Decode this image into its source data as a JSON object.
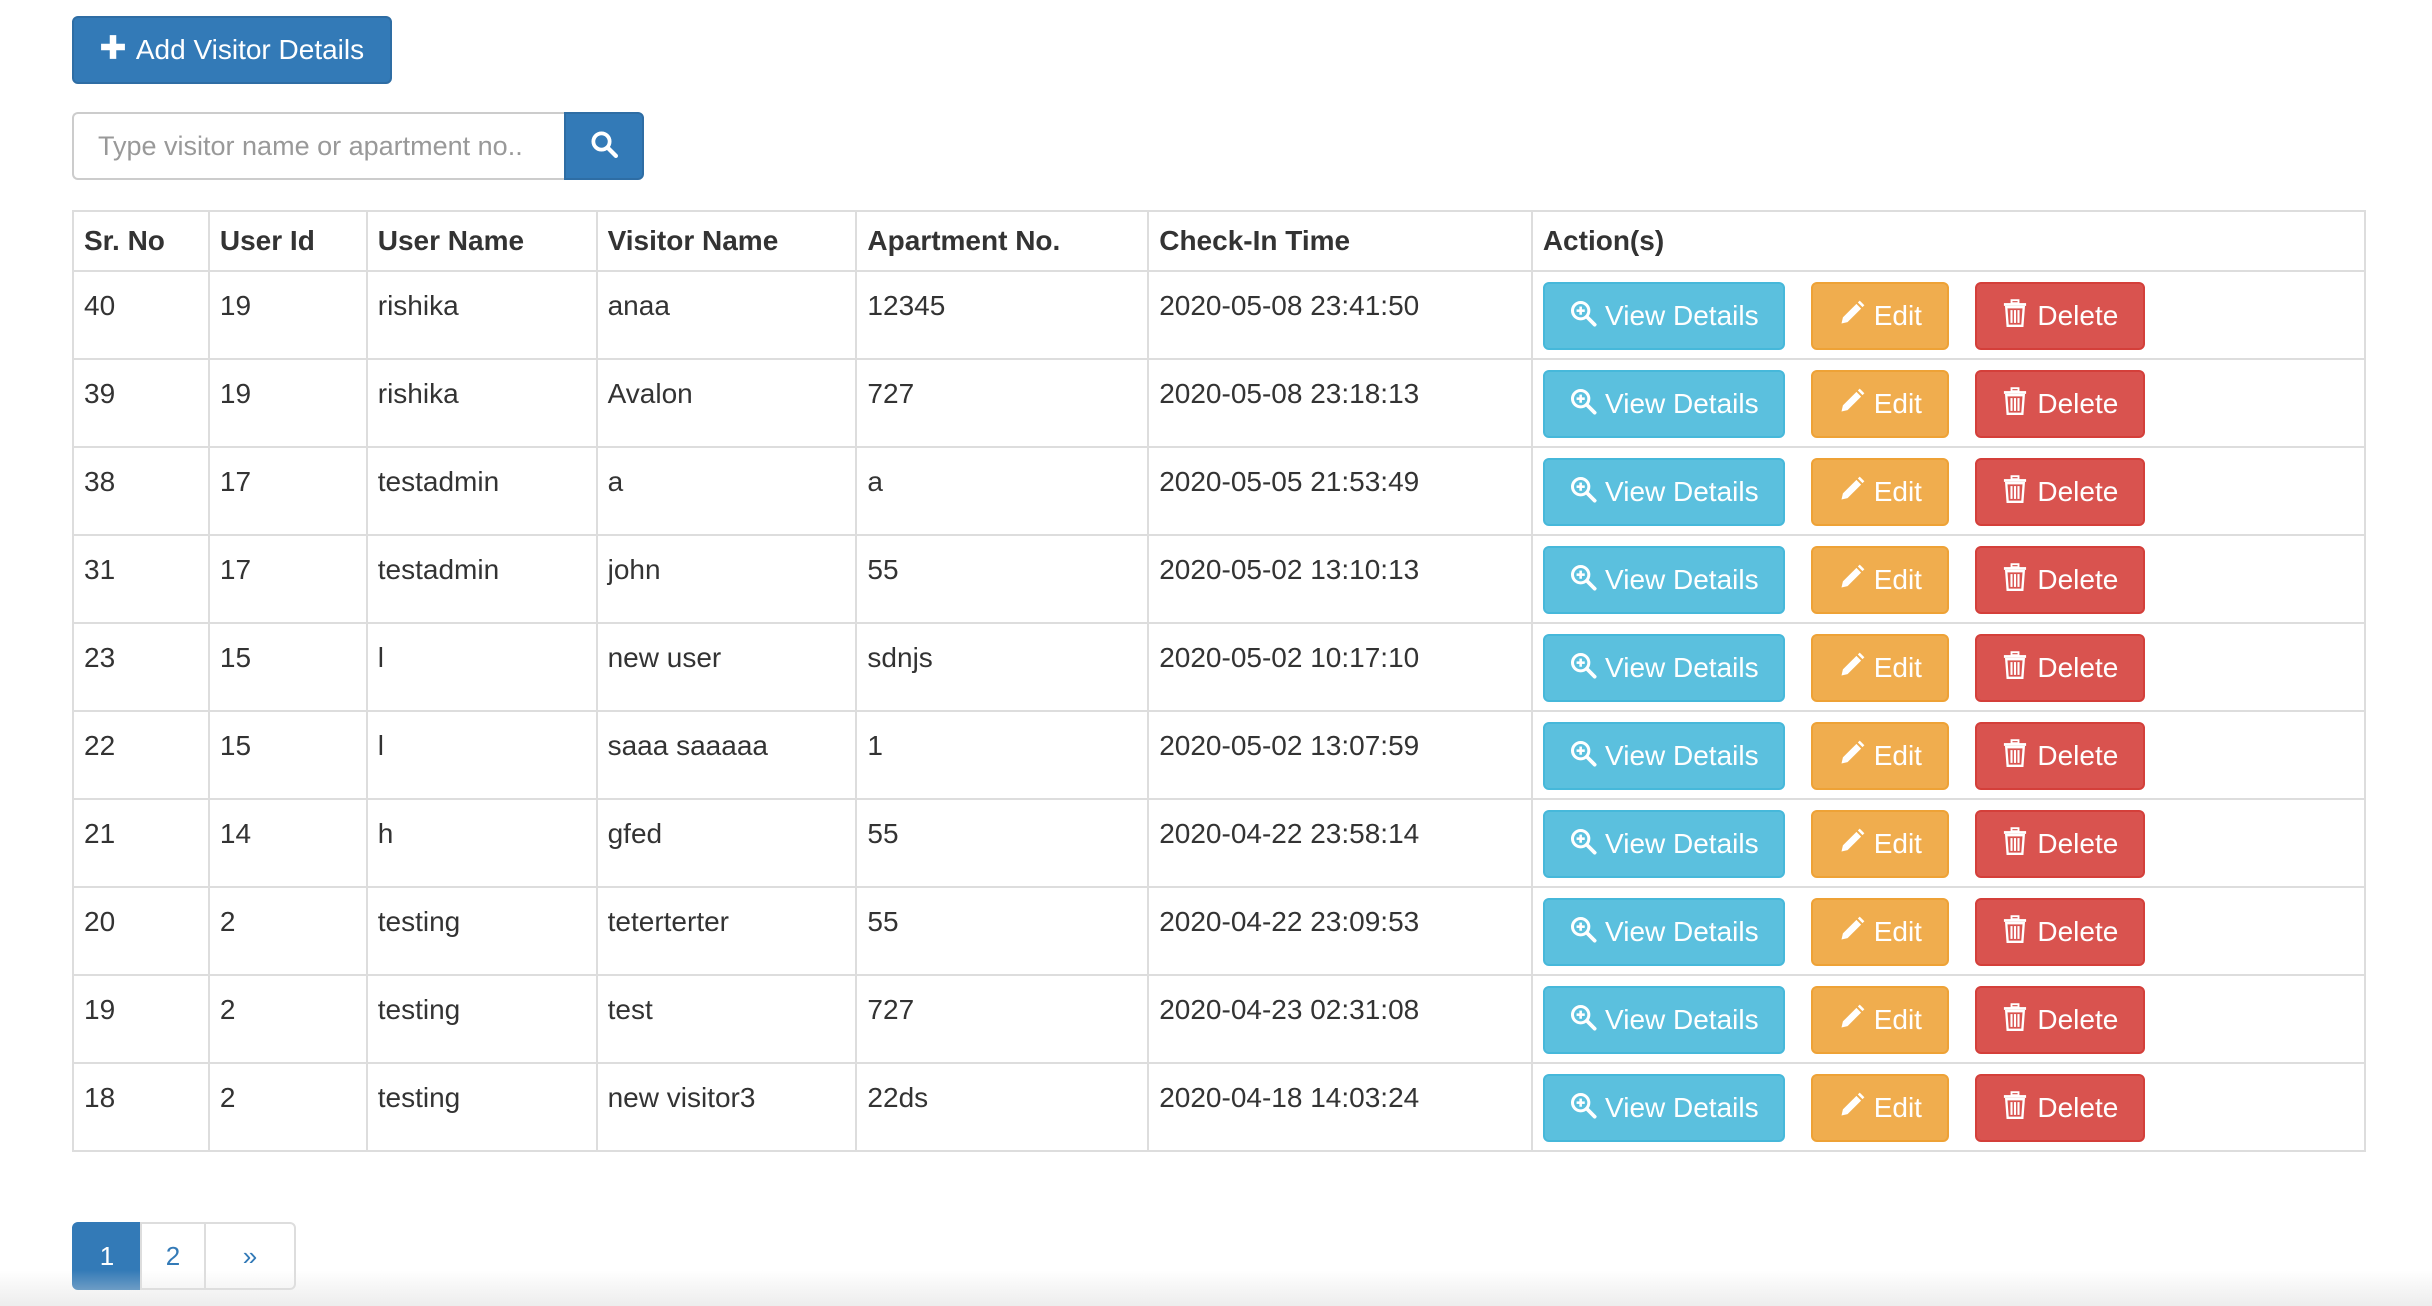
{
  "toolbar": {
    "add_label": "Add Visitor Details"
  },
  "search": {
    "placeholder": "Type visitor name or apartment no.."
  },
  "table": {
    "headers": [
      "Sr. No",
      "User Id",
      "User Name",
      "Visitor Name",
      "Apartment No.",
      "Check-In Time",
      "Action(s)"
    ],
    "rows": [
      {
        "sr": "40",
        "user_id": "19",
        "user_name": "rishika",
        "visitor": "anaa",
        "apt": "12345",
        "time": "2020-05-08 23:41:50"
      },
      {
        "sr": "39",
        "user_id": "19",
        "user_name": "rishika",
        "visitor": "Avalon",
        "apt": "727",
        "time": "2020-05-08 23:18:13"
      },
      {
        "sr": "38",
        "user_id": "17",
        "user_name": "testadmin",
        "visitor": "a",
        "apt": "a",
        "time": "2020-05-05 21:53:49"
      },
      {
        "sr": "31",
        "user_id": "17",
        "user_name": "testadmin",
        "visitor": "john",
        "apt": "55",
        "time": "2020-05-02 13:10:13"
      },
      {
        "sr": "23",
        "user_id": "15",
        "user_name": "l",
        "visitor": "new user",
        "apt": "sdnjs",
        "time": "2020-05-02 10:17:10"
      },
      {
        "sr": "22",
        "user_id": "15",
        "user_name": "l",
        "visitor": "saaa saaaaa",
        "apt": "1",
        "time": "2020-05-02 13:07:59"
      },
      {
        "sr": "21",
        "user_id": "14",
        "user_name": "h",
        "visitor": "gfed",
        "apt": "55",
        "time": "2020-04-22 23:58:14"
      },
      {
        "sr": "20",
        "user_id": "2",
        "user_name": "testing",
        "visitor": "teterterter",
        "apt": "55",
        "time": "2020-04-22 23:09:53"
      },
      {
        "sr": "19",
        "user_id": "2",
        "user_name": "testing",
        "visitor": "test",
        "apt": "727",
        "time": "2020-04-23 02:31:08"
      },
      {
        "sr": "18",
        "user_id": "2",
        "user_name": "testing",
        "visitor": "new visitor3",
        "apt": "22ds",
        "time": "2020-04-18 14:03:24"
      }
    ],
    "actions": {
      "view": "View Details",
      "edit": "Edit",
      "delete": "Delete"
    }
  },
  "pagination": {
    "pages": [
      "1",
      "2"
    ],
    "next": "»",
    "active_page": "1"
  },
  "colors": {
    "primary": "#337ab7",
    "info": "#5bc0de",
    "warning": "#f0ad4e",
    "danger": "#d9534f"
  },
  "icons": {
    "add": "plus-icon",
    "search": "search-icon",
    "view": "zoom-in-icon",
    "edit": "pencil-icon",
    "delete": "trash-icon"
  }
}
